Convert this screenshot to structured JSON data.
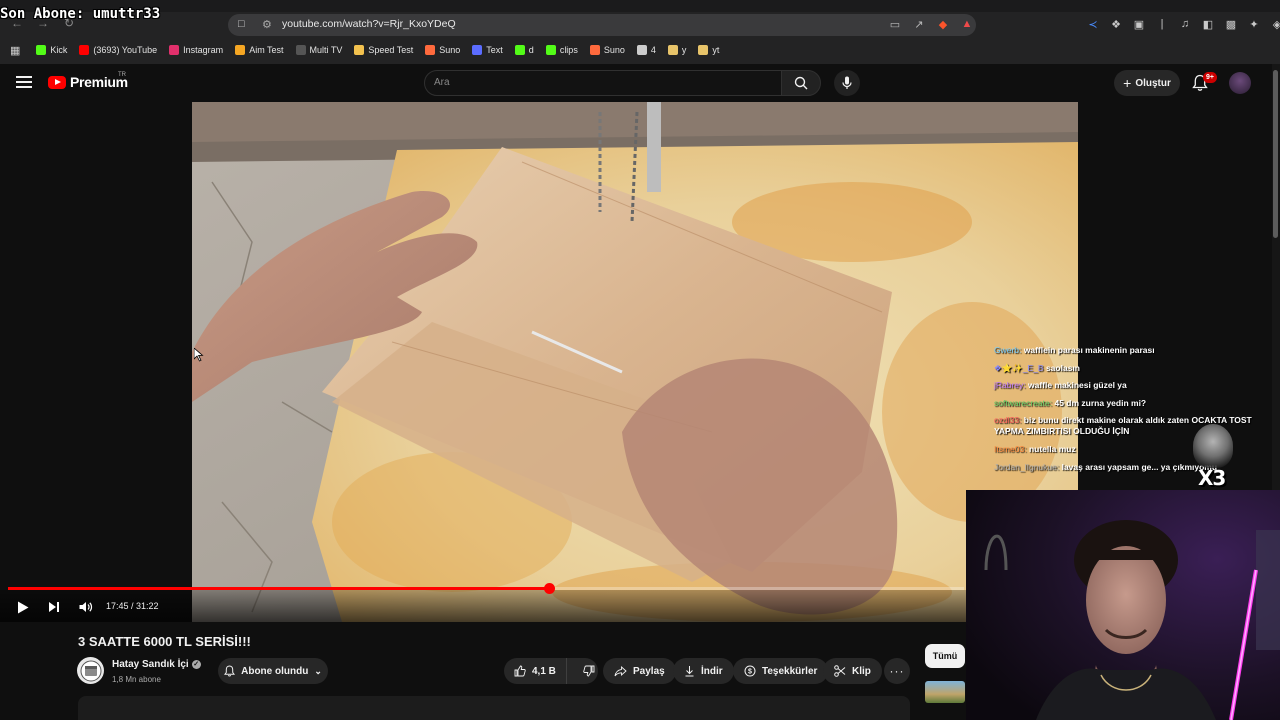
{
  "stream_overlay": {
    "last_subscriber": "Son Abone: umuttr33"
  },
  "browser": {
    "url": "youtube.com/watch?v=Rjr_KxoYDeQ",
    "bookmarks": [
      {
        "label": "Kick",
        "icon": "kick-icon",
        "color": "#53fc18"
      },
      {
        "label": "(3693) YouTube",
        "icon": "youtube-icon",
        "color": "#ff0000"
      },
      {
        "label": "Instagram",
        "icon": "instagram-icon",
        "color": "#e1306c"
      },
      {
        "label": "Aim Test",
        "icon": "aim-test-icon",
        "color": "#f5a623"
      },
      {
        "label": "Multi TV",
        "icon": "multi-tv-icon",
        "color": "#555555"
      },
      {
        "label": "Speed Test",
        "icon": "speed-test-icon",
        "color": "#f2c14e"
      },
      {
        "label": "Suno",
        "icon": "suno-icon",
        "color": "#ff6a3d"
      },
      {
        "label": "Text",
        "icon": "text-icon",
        "color": "#5b6cff"
      },
      {
        "label": "d",
        "icon": "kick-icon",
        "color": "#53fc18"
      },
      {
        "label": "clips",
        "icon": "clips-icon",
        "color": "#53fc18"
      },
      {
        "label": "Suno",
        "icon": "suno-icon",
        "color": "#ff6a3d"
      },
      {
        "label": "4",
        "icon": "circle-icon",
        "color": "#cccccc"
      },
      {
        "label": "y",
        "icon": "folder-icon",
        "color": "#e8c46a"
      },
      {
        "label": "yt",
        "icon": "folder-icon",
        "color": "#e8c46a"
      }
    ]
  },
  "youtube": {
    "brand": "Premium",
    "region": "TR",
    "search_placeholder": "Ara",
    "create_label": "Oluştur",
    "notification_count": "9+"
  },
  "player": {
    "time": "17:45 / 31:22",
    "progress": 0.5657
  },
  "chat": [
    {
      "user": "Gwerb:",
      "user_color": "#7ad0ff",
      "text": "wafflein parası makinenin parası"
    },
    {
      "user": "❖⭐✨_E_B",
      "user_color": "#8a8aff",
      "text": "saolasın"
    },
    {
      "user": "jRabrey:",
      "user_color": "#c07aff",
      "text": "waffle makinesi güzel ya"
    },
    {
      "user": "softwarecreate:",
      "user_color": "#5fcf66",
      "text": "45 dm zurna yedin mi?"
    },
    {
      "user": "ozdl33:",
      "user_color": "#ff5a5a",
      "text": "biz bunu direkt makine olarak aldık zaten OCAKTA TOST YAPMA ZIMBIRTISI OLDUĞU İÇİN"
    },
    {
      "user": "Itsme03:",
      "user_color": "#ff8a3d",
      "text": "nutella muz"
    },
    {
      "user": "Jordan_lIgnukue:",
      "user_color": "#b0b0b0",
      "text": "lavaş arası yapsam ge... ya çıkmıyomu"
    }
  ],
  "chat_multiplier": "X3",
  "video": {
    "title": "3 SAATTE 6000 TL SERİSİ!!!",
    "channel": "Hatay Sandık İçi",
    "subscribers": "1,8 Mn abone",
    "subscribe_label": "Abone olundu",
    "likes": "4,1 B",
    "share_label": "Paylaş",
    "download_label": "İndir",
    "thanks_label": "Teşekkürler",
    "clip_label": "Klip"
  },
  "sidebar": {
    "filter_all": "Tümü"
  }
}
